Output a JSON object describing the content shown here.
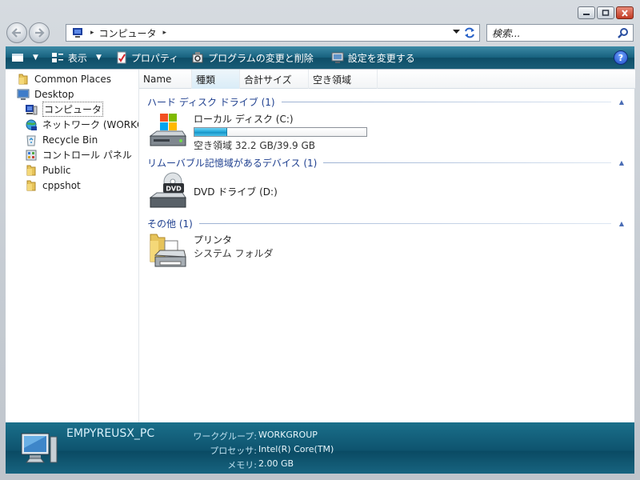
{
  "window": {
    "buttons": [
      "minimize",
      "maximize",
      "close"
    ]
  },
  "nav": {
    "address_crumbs": [
      "コンピュータ"
    ],
    "search_placeholder": "検索..."
  },
  "toolbar": {
    "view_label": "",
    "display_label": "表示",
    "properties_label": "プロパティ",
    "programs_label": "プログラムの変更と削除",
    "settings_label": "設定を変更する",
    "help_label": "?"
  },
  "sidebar": {
    "items": [
      {
        "label": "Common Places",
        "icon": "folder-icon"
      },
      {
        "label": "Desktop",
        "icon": "desktop-icon"
      },
      {
        "label": "コンピュータ",
        "icon": "computer-icon",
        "selected": true
      },
      {
        "label": "ネットワーク (WORKGROUP)",
        "icon": "network-icon"
      },
      {
        "label": "Recycle Bin",
        "icon": "recycle-bin-icon"
      },
      {
        "label": "コントロール パネル",
        "icon": "control-panel-icon"
      },
      {
        "label": "Public",
        "icon": "folder-icon"
      },
      {
        "label": "cppshot",
        "icon": "folder-icon"
      }
    ]
  },
  "columns": [
    "Name",
    "種類",
    "合計サイズ",
    "空き領域"
  ],
  "groups": [
    {
      "title": "ハード ディスク ドライブ (1)",
      "items": [
        {
          "name": "ローカル ディスク (C:)",
          "detail": "空き領域 32.2 GB/39.9 GB",
          "used_fraction": 0.19,
          "icon": "hard-drive-icon"
        }
      ]
    },
    {
      "title": "リムーバブル記憶域があるデバイス (1)",
      "items": [
        {
          "name": "DVD ドライブ (D:)",
          "detail": "",
          "icon": "dvd-drive-icon",
          "badge": "DVD"
        }
      ]
    },
    {
      "title": "その他 (1)",
      "items": [
        {
          "name": "プリンタ",
          "detail": "システム フォルダ",
          "icon": "printer-folder-icon"
        }
      ]
    }
  ],
  "details": {
    "pc_name": "EMPYREUSX_PC",
    "rows": [
      {
        "key": "ワークグループ:",
        "value": "WORKGROUP"
      },
      {
        "key": "プロセッサ:",
        "value": "Intel(R) Core(TM)"
      },
      {
        "key": "メモリ:",
        "value": "2.00 GB"
      }
    ]
  },
  "colors": {
    "toolbar": "#17617e",
    "group_title": "#1e3f8f",
    "progress_fill": "#1fa5d8"
  }
}
